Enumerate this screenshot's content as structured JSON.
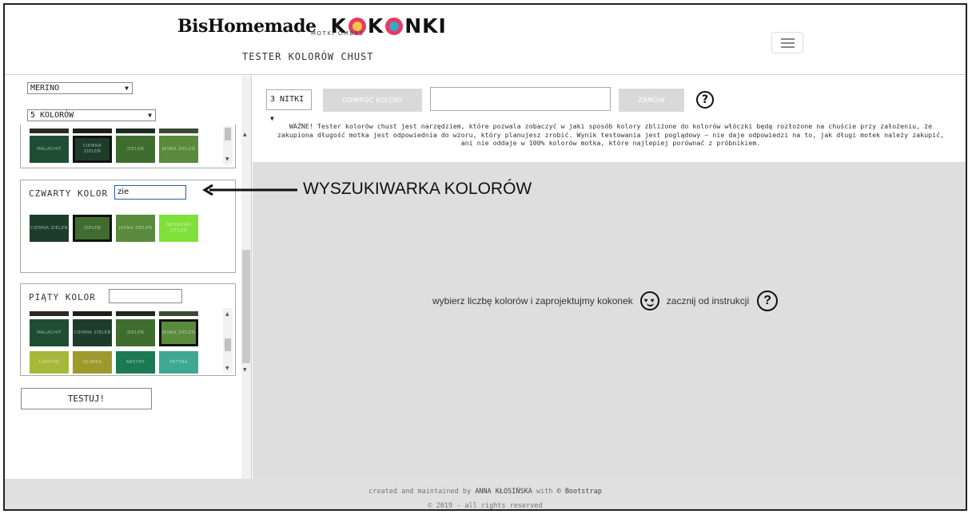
{
  "header": {
    "logo_bis": "BisHomemade",
    "logo_kokonki_pre": "K",
    "logo_kokonki_mid": "K",
    "logo_kokonki_post": "NKI",
    "logo_motki": "MOTKI OMBRE",
    "subtitle": "TESTER KOLORÓW CHUST"
  },
  "sidebar": {
    "material_select": "MERINO",
    "count_select": "5 KOLORÓW",
    "panel3_swatches": [
      "MALACHIT",
      "CIEMNA ZIELEŃ",
      "ZIELEŃ",
      "JASNA ZIELEŃ"
    ],
    "panel4": {
      "label": "CZWARTY KOLOR",
      "search_value": "zie",
      "swatches": [
        "CIEMNA ZIELEŃ",
        "ZIELEŃ",
        "JASNA ZIELEŃ",
        "NEONOWA ZIELEŃ"
      ]
    },
    "panel5": {
      "label": "PIĄTY KOLOR",
      "search_value": "",
      "swatches_row1": [
        "MALACHIT",
        "CIEMNA ZIELEŃ",
        "ZIELEŃ",
        "JASNA ZIELEŃ"
      ],
      "swatches_row2": [
        "LIMETKA",
        "OLIWKA",
        "ABSYNT",
        "PATYNA"
      ]
    },
    "test_button": "TESTUJ!"
  },
  "toolbar": {
    "nitki_select": "3 NITKI",
    "reverse_button": "ODWRÓĆ KOLORY",
    "order_button": "ZAMÓW",
    "help_glyph": "?"
  },
  "warning": {
    "line1": "WAŻNE! Tester kolorów chust jest narzędziem, które pozwala zobaczyć w jaki sposób kolory zbliżone do kolorów włóczki będą rozłożone na chuście przy założeniu, że",
    "line2": "zakupiona długość motka jest odpowiednia do wzoru, który planujesz zrobić. Wynik testowania jest poglądowy – nie daje odpowiedzi na to, jak długi motek należy zakupić,",
    "line3": "ani nie oddaje w 100% kolorów motka, które najlepiej porównać z próbnikiem."
  },
  "main_message": {
    "part1": "wybierz liczbę kolorów i zaprojektujmy kokonek",
    "part2": "zacznij od instrukcji",
    "help_glyph": "?"
  },
  "annotation": "WYSZUKIWARKA KOLORÓW",
  "footer": {
    "line1_pre": "created and maintained by",
    "author": "ANNA KŁOSIŃSKA",
    "line1_mid": "with",
    "tool": "© Bootstrap",
    "line2": "© 2019 - all rights reserved"
  },
  "colors": {
    "malachit": "#1f4d33",
    "ciemna_zielen": "#1d3d2a",
    "zielen": "#3f6d2f",
    "jasna_zielen": "#5a8a3b",
    "neonowa_zielen": "#7fe03a",
    "limetka": "#a6b83a",
    "oliwka": "#9d9a2d",
    "absynt": "#1b7a52",
    "patyna": "#3fa893",
    "ring_pink": "#e83a63",
    "ring_yellow": "#f6c745",
    "ring_blue": "#3aa6c7"
  }
}
